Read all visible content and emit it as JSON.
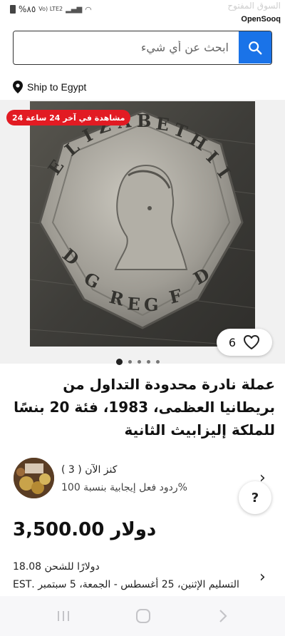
{
  "status_bar": {
    "battery_percent": "%٨٥",
    "network": "Vo) LTE2",
    "opensooq_arabic": "السوق المفتوح",
    "opensooq_brand": "OpenSooq"
  },
  "search": {
    "placeholder": "ابحث عن أي شيء",
    "value": "",
    "button_icon": "search-icon"
  },
  "ship_to": {
    "label": "Ship to Egypt",
    "icon": "location-pin-icon"
  },
  "gallery": {
    "badge": "مشاهدة في آخر 24 ساعة 24",
    "favorite_count": "6",
    "favorite_icon": "heart-icon",
    "total_images": 5,
    "active_image": 1
  },
  "listing": {
    "title": "عملة نادرة محدودة التداول من بريطانيا العظمى، 1983، فئة 20 بنسًا للملكة إليزابيث الثانية",
    "price": "دولار 3,500.00"
  },
  "seller": {
    "name": "كنز الآن ( 3 )",
    "feedback": "%ردود فعل إيجابية بنسبة 100"
  },
  "shipping": {
    "cost": "دولارًا للشحن 18.08",
    "delivery": "التسليم الإثنين، 25 أغسطس - الجمعة، 5 سبتمبر .EST"
  },
  "help_button": "?",
  "colors": {
    "accent": "#1a73e8",
    "badge": "#e21b23"
  }
}
